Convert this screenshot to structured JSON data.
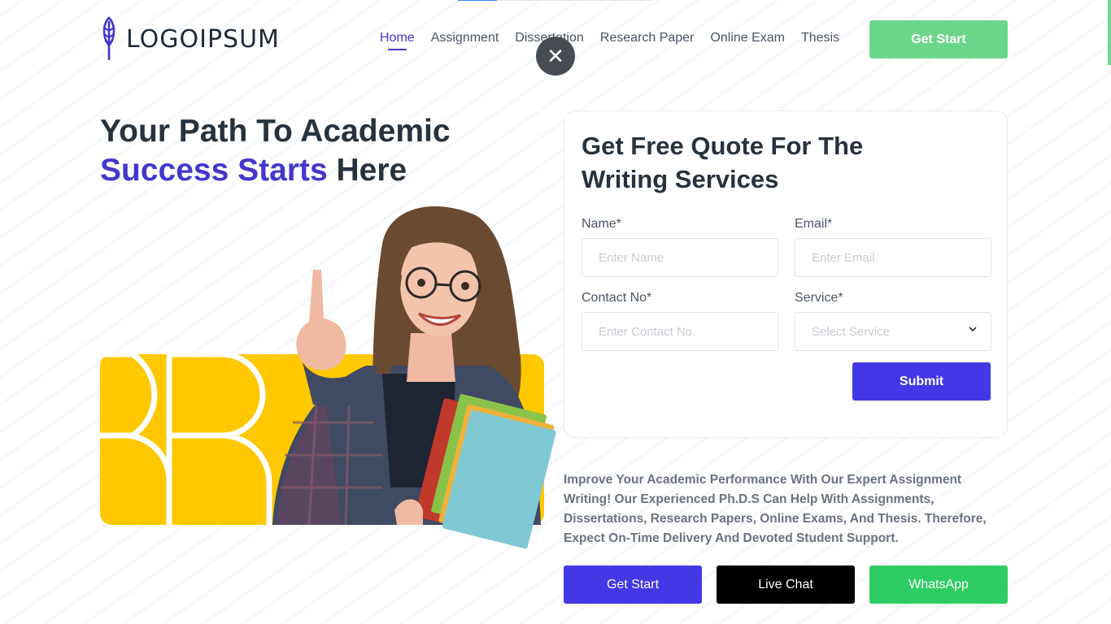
{
  "brand": {
    "name": "LOGOIPSUM",
    "accent_color": "#4338ca",
    "green_color": "#6bd68a"
  },
  "nav": {
    "items": [
      {
        "label": "Home",
        "active": true
      },
      {
        "label": "Assignment",
        "active": false
      },
      {
        "label": "Dissertation",
        "active": false
      },
      {
        "label": "Research Paper",
        "active": false
      },
      {
        "label": "Online Exam",
        "active": false
      },
      {
        "label": "Thesis",
        "active": false
      }
    ],
    "cta_label": "Get Start"
  },
  "top_progress": {
    "percent": 20
  },
  "overlay": {
    "close_icon": "close-icon",
    "close_glyph": "✕"
  },
  "hero": {
    "title_line1": "Your Path To Academic",
    "title_accent": "Success Starts",
    "title_rest": " Here"
  },
  "quote_form": {
    "title_line1": "Get Free Quote For The",
    "title_line2": "Writing Services",
    "name": {
      "label": "Name*",
      "placeholder": "Enter Name",
      "value": ""
    },
    "email": {
      "label": "Email*",
      "placeholder": "Enter Email",
      "value": ""
    },
    "contact": {
      "label": "Contact No*",
      "placeholder": "Enter Contact No.",
      "value": ""
    },
    "service": {
      "label": "Service*",
      "selected": "Select Service",
      "icon": "chevron-down-icon"
    },
    "submit_label": "Submit"
  },
  "description": "Improve Your Academic Performance With Our Expert Assignment Writing! Our Experienced Ph.D.S Can Help With Assignments, Dissertations, Research Papers, Online Exams, And Thesis. Therefore, Expect On-Time Delivery And Devoted Student Support.",
  "actions": {
    "get_start": "Get Start",
    "live_chat": "Live Chat",
    "whatsapp": "WhatsApp"
  }
}
